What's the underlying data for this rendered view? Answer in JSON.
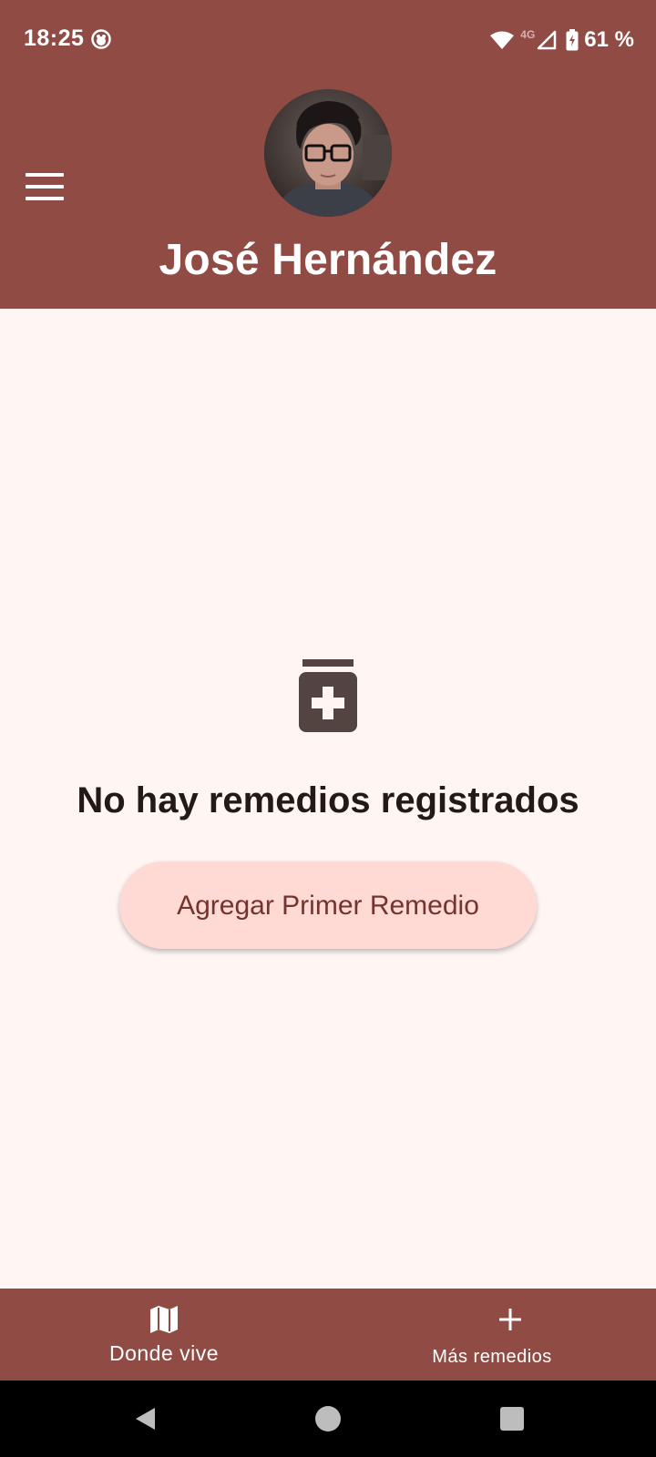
{
  "status_bar": {
    "time": "18:25",
    "network_type": "4G",
    "battery": "61 %",
    "icons": [
      "app-notification-icon",
      "wifi-icon",
      "signal-icon",
      "battery-charging-icon"
    ]
  },
  "header": {
    "menu_icon": "hamburger-menu-icon",
    "user_name": "José Hernández",
    "avatar_description": "user-avatar-photo"
  },
  "empty_state": {
    "icon": "medicine-bottle-icon",
    "message": "No hay remedios registrados",
    "button_label": "Agregar Primer Remedio"
  },
  "bottom_nav": {
    "items": [
      {
        "label": "Donde vive",
        "icon": "map-icon"
      },
      {
        "label": "Más remedios",
        "icon": "plus-icon"
      }
    ]
  },
  "system_nav": {
    "buttons": [
      "back-icon",
      "home-icon",
      "recents-icon"
    ]
  },
  "colors": {
    "primary": "#904b45",
    "background": "#fff6f4",
    "button_bg": "#ffdad5",
    "button_text": "#73342f",
    "text_dark": "#231917",
    "icon_dark": "#534341"
  }
}
